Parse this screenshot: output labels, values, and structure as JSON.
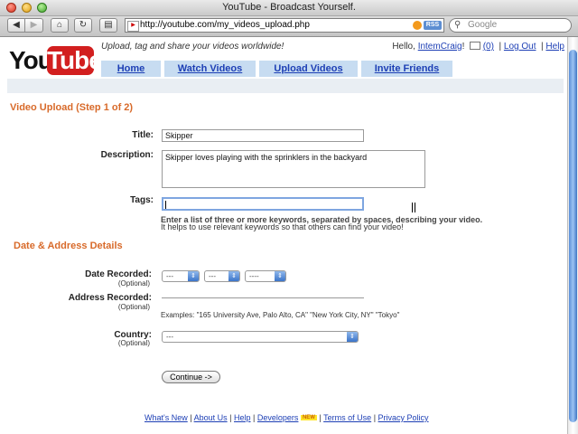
{
  "window": {
    "title": "YouTube - Broadcast Yourself."
  },
  "browser": {
    "url": "http://youtube.com/my_videos_upload.php",
    "rss_label": "RSS",
    "search_placeholder": "Google",
    "back_glyph": "◀",
    "forward_glyph": "▶",
    "home_glyph": "⌂",
    "reload_glyph": "↻",
    "print_glyph": "▤"
  },
  "header": {
    "logo_you": "You",
    "logo_tube": "Tube",
    "tagline": "Upload, tag and share your videos worldwide!",
    "hello": "Hello, ",
    "username": "IntemCraig",
    "mail_count": "(0)",
    "logout": "Log Out",
    "help": "Help"
  },
  "tabs": [
    {
      "label": "Home"
    },
    {
      "label": "Watch Videos"
    },
    {
      "label": "Upload Videos"
    },
    {
      "label": "Invite Friends"
    }
  ],
  "form": {
    "section_title": "Video Upload (Step 1 of 2)",
    "title_label": "Title:",
    "title_value": "Skipper",
    "description_label": "Description:",
    "description_value": "Skipper loves playing with the sprinklers in the backyard",
    "tags_label": "Tags:",
    "tags_value": "",
    "tags_hint_1": "Enter a list of three or more keywords, separated by spaces, describing your video.",
    "tags_hint_2": "It helps to use relevant keywords so that others can find your video!",
    "date_section_title": "Date & Address Details",
    "date_label": "Date Recorded:",
    "optional": "(Optional)",
    "date_month": "---",
    "date_day": "---",
    "date_year": "----",
    "address_label": "Address Recorded:",
    "address_examples": "Examples: \"165 University Ave, Palo Alto, CA\"   \"New York City, NY\"   \"Tokyo\"",
    "country_label": "Country:",
    "country_value": "---",
    "continue_label": "Continue ->"
  },
  "footer": {
    "links": [
      "What's New",
      "About Us",
      "Help",
      "Developers",
      "Terms of Use",
      "Privacy Policy"
    ],
    "new_badge": "NEW"
  }
}
